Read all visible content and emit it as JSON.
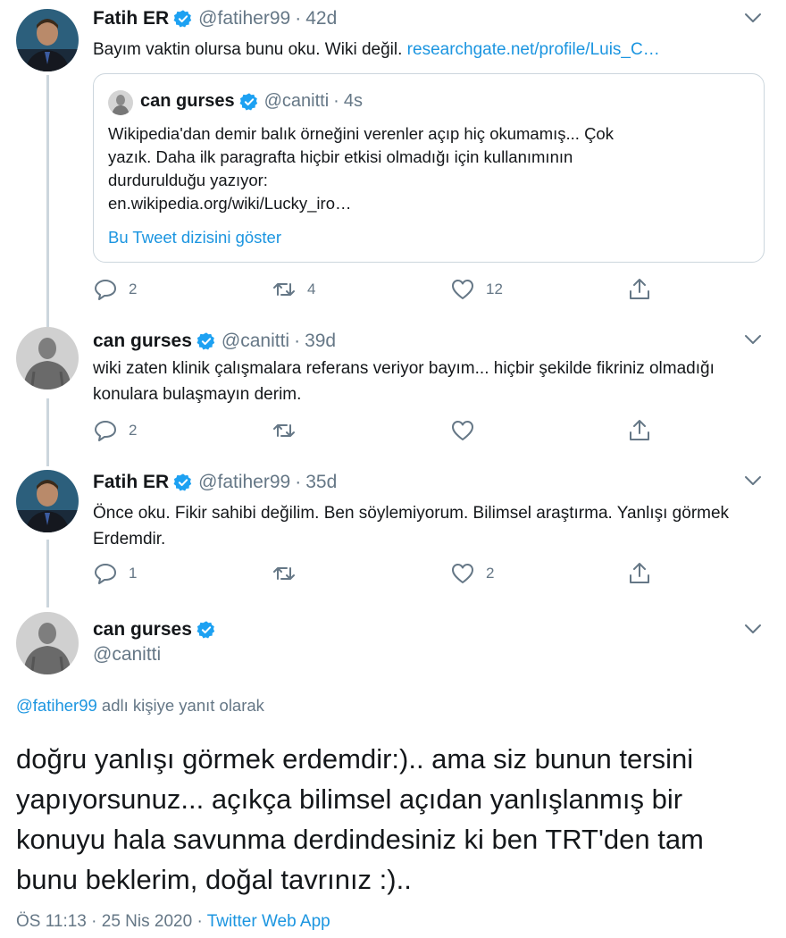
{
  "tweets": [
    {
      "name": "Fatih ER",
      "handle": "@fatiher99",
      "separator": "·",
      "time": "42d",
      "text": "Bayım vaktin olursa bunu oku. Wiki değil. ",
      "link": "researchgate.net/profile/Luis_C…",
      "quote": {
        "name": "can gurses",
        "handle": "@canitti",
        "separator": "·",
        "time": "4s",
        "lines": [
          "Wikipedia'dan demir balık örneğini verenler açıp hiç okumamış... Çok",
          "yazık. Daha ilk paragrafta hiçbir etkisi olmadığı için kullanımının",
          "durdurulduğu yazıyor:",
          "en.wikipedia.org/wiki/Lucky_iro…"
        ],
        "show_thread": "Bu Tweet dizisini göster"
      },
      "reply_count": "2",
      "retweet_count": "4",
      "like_count": "12"
    },
    {
      "name": "can gurses",
      "handle": "@canitti",
      "separator": "·",
      "time": "39d",
      "text": "wiki zaten klinik çalışmalara referans veriyor bayım... hiçbir şekilde fikriniz olmadığı konulara bulaşmayın derim.",
      "reply_count": "2",
      "retweet_count": "",
      "like_count": ""
    },
    {
      "name": "Fatih ER",
      "handle": "@fatiher99",
      "separator": "·",
      "time": "35d",
      "text": "Önce oku.  Fikir sahibi değilim. Ben söylemiyorum. Bilimsel araştırma.  Yanlışı görmek Erdemdir.",
      "reply_count": "1",
      "retweet_count": "",
      "like_count": "2"
    }
  ],
  "main": {
    "name": "can gurses",
    "handle": "@canitti",
    "reply_handle": "@fatiher99",
    "reply_suffix": " adlı kişiye yanıt olarak",
    "lines": [
      "doğru yanlışı görmek erdemdir:).. ama siz bunun tersini",
      "yapıyorsunuz... açıkça bilimsel açıdan yanlışlanmış bir",
      "konuyu hala savunma derdindesiniz ki ben TRT'den tam",
      "bunu beklerim, doğal tavrınız :).."
    ],
    "time": "ÖS 11:13",
    "separator1": " · ",
    "date": "25 Nis 2020",
    "separator2": " · ",
    "source": "Twitter Web App"
  },
  "colors": {
    "accent": "#1b95e0",
    "verified": "#1da1f2",
    "muted": "#657786",
    "border": "#ccd6dd"
  },
  "icons": [
    "verified-badge-icon",
    "chevron-down-icon",
    "reply-icon",
    "retweet-icon",
    "like-icon",
    "share-icon"
  ]
}
